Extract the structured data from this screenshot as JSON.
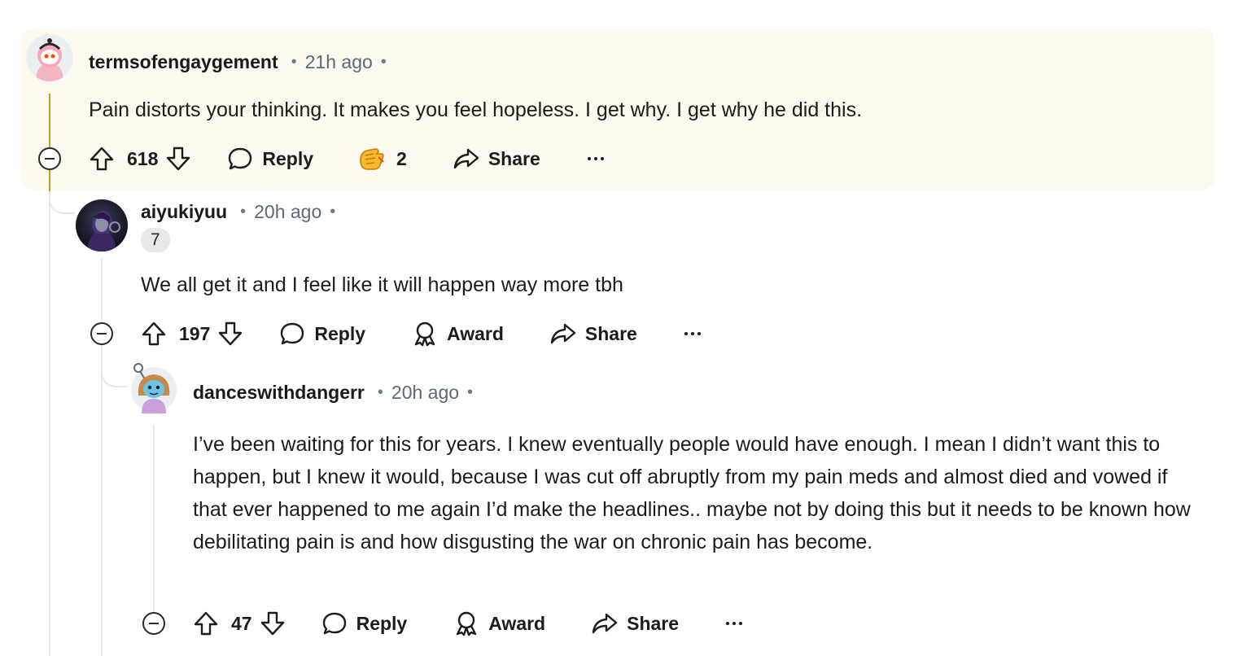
{
  "comments": [
    {
      "username": "termsofengaygement",
      "time": "21h ago",
      "body": "Pain distorts your thinking. It makes you feel hopeless. I get why. I get why he did this.",
      "votes": "618",
      "reply_label": "Reply",
      "award_count": "2",
      "share_label": "Share",
      "highlighted": true
    },
    {
      "username": "aiyukiyuu",
      "time": "20h ago",
      "flair": "7",
      "body": "We all get it and I feel like it will happen way more tbh",
      "votes": "197",
      "reply_label": "Reply",
      "award_label": "Award",
      "share_label": "Share"
    },
    {
      "username": "danceswithdangerr",
      "time": "20h ago",
      "body": "I’ve been waiting for this for years. I knew eventually people would have enough. I mean I didn’t want this to happen, but I knew it would, because I was cut off abruptly from my pain meds and almost died and vowed if that ever happened to me again I’d make the headlines.. maybe not by doing this but it needs to be known how debilitating pain is and how disgusting the war on chronic pain has become.",
      "votes": "47",
      "reply_label": "Reply",
      "award_label": "Award",
      "share_label": "Share"
    }
  ],
  "colors": {
    "highlight_bg": "#fdf9ee",
    "thread_line": "#e5e7eb",
    "highlight_line": "#c99b1a",
    "meta_text": "#5a6b78"
  },
  "icons": [
    "upvote-icon",
    "downvote-icon",
    "reply-bubble-icon",
    "award-icon",
    "share-arrow-icon",
    "more-dots-icon",
    "collapse-minus-icon",
    "hand-award-icon"
  ]
}
